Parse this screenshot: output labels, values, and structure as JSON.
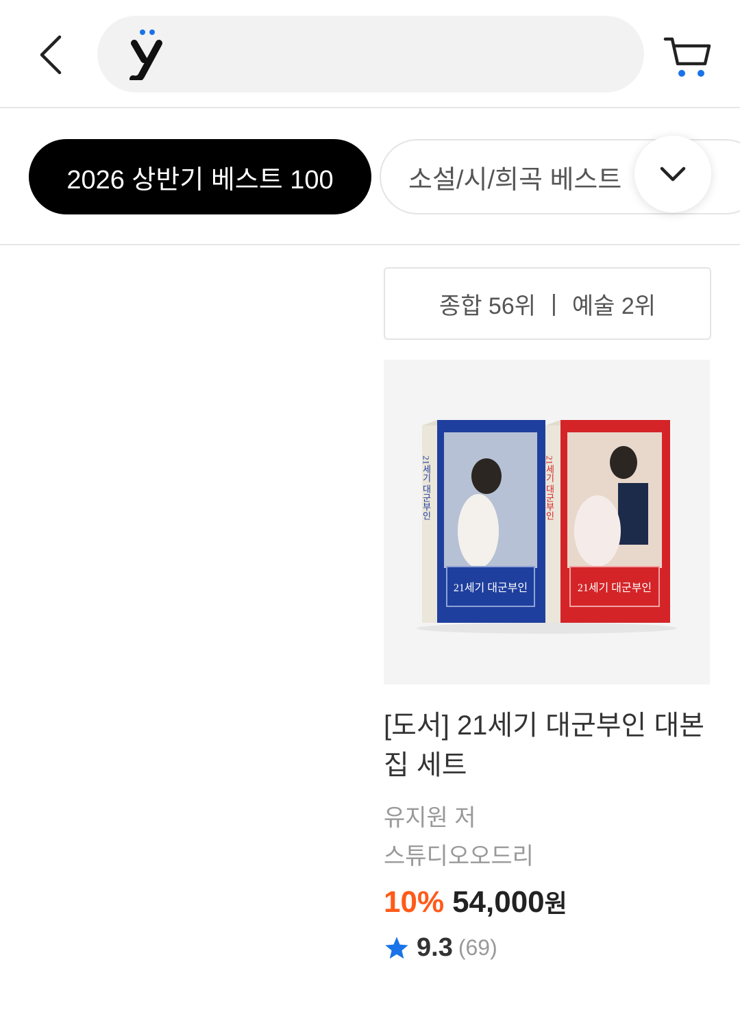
{
  "header": {
    "back_icon": "chevron-left-icon",
    "logo_icon": "y-umlaut-logo",
    "search_placeholder": "",
    "cart_icon": "cart-icon"
  },
  "tabs": {
    "items": [
      {
        "label": "2026 상반기 베스트 100",
        "active": true
      },
      {
        "label": "소설/시/희곡 베스트",
        "active": false
      }
    ],
    "expand_icon": "chevron-down-icon"
  },
  "product": {
    "rank_overall": "종합 56위",
    "rank_separator": "|",
    "rank_category": "예술 2위",
    "image_text": {
      "left_spine": "21세기 대군부인",
      "left_cover": "21세기 대군부인",
      "right_spine": "21세기 대군부인",
      "right_cover": "21세기 대군부인"
    },
    "title": "[도서] 21세기 대군부인 대본집 세트",
    "author": "유지원 저",
    "publisher": "스튜디오오드리",
    "discount": "10%",
    "price": "54,000",
    "currency": "원",
    "rating": "9.3",
    "review_count": "(69)"
  },
  "colors": {
    "accent_blue": "#1a73e8",
    "discount_orange": "#ff5a1a",
    "active_tab_bg": "#000000",
    "cover_blue": "#1f3f9e",
    "cover_red": "#d42428"
  }
}
